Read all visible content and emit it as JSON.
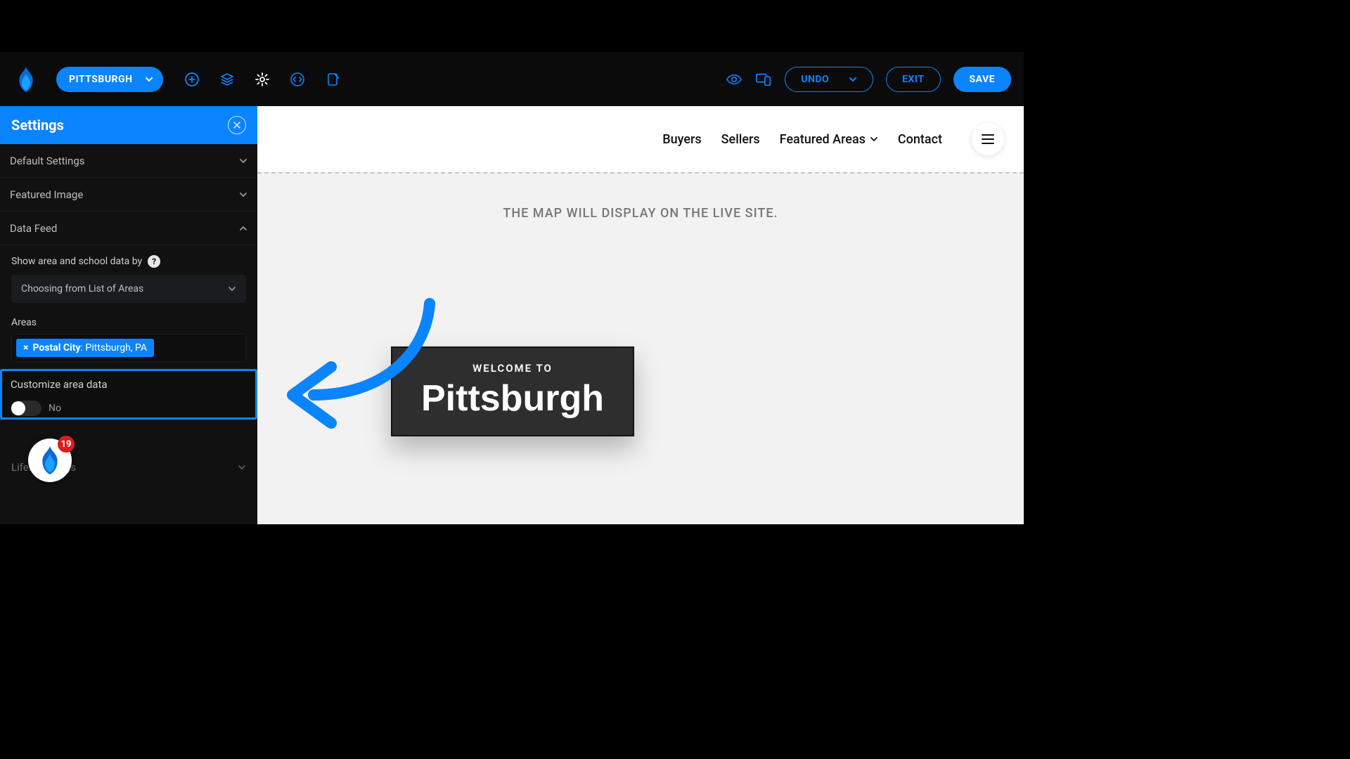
{
  "toolbar": {
    "page_pill": "PITTSBURGH",
    "undo_label": "UNDO",
    "exit_label": "EXIT",
    "save_label": "SAVE"
  },
  "sidebar": {
    "panel_title": "Settings",
    "sections": {
      "default_settings": "Default Settings",
      "featured_image": "Featured Image",
      "data_feed": "Data Feed",
      "lifestyle_tags": "Lifestyle Tags"
    },
    "data_feed": {
      "show_area_label": "Show area and school data by",
      "show_area_value": "Choosing from List of Areas",
      "areas_label": "Areas",
      "area_tag_prefix": "Postal City",
      "area_tag_value": ": Pittsburgh, PA",
      "customize_label": "Customize area data",
      "customize_value": "No"
    },
    "chat_badge": "19"
  },
  "preview": {
    "nav": {
      "buyers": "Buyers",
      "sellers": "Sellers",
      "featured_areas": "Featured Areas",
      "contact": "Contact"
    },
    "map_note": "THE MAP WILL DISPLAY ON THE LIVE SITE.",
    "welcome_sub": "WELCOME TO",
    "welcome_title": "Pittsburgh"
  },
  "colors": {
    "accent": "#0a84ff",
    "danger": "#d91d1d"
  }
}
